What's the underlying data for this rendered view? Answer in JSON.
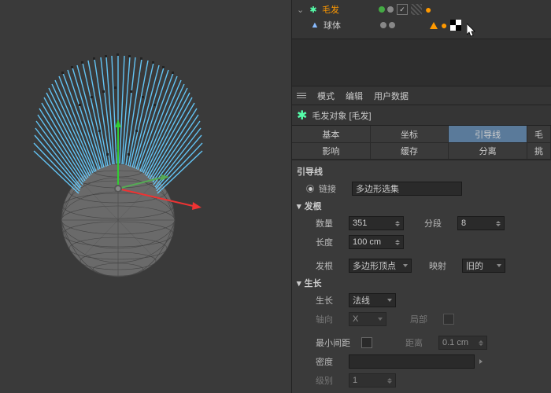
{
  "hierarchy": {
    "hair": "毛发",
    "sphere": "球体"
  },
  "menu": {
    "mode": "模式",
    "edit": "编辑",
    "userdata": "用户数据"
  },
  "object_title": "毛发对象 [毛发]",
  "tabs1": {
    "basic": "基本",
    "coord": "坐标",
    "guides": "引导线",
    "hair": "毛"
  },
  "tabs2": {
    "effects": "影响",
    "cache": "缓存",
    "separate": "分离",
    "advanced": "挑"
  },
  "sections": {
    "guides_header": "引导线",
    "link_label": "链接",
    "link_value": "多边形选集",
    "roots_header": "发根",
    "count_label": "数量",
    "count_value": "351",
    "segments_label": "分段",
    "segments_value": "8",
    "length_label": "长度",
    "length_value": "100 cm",
    "root_label": "发根",
    "root_value": "多边形顶点",
    "map_label": "映射",
    "map_value": "旧的",
    "growth_header": "生长",
    "growth_label": "生长",
    "growth_value": "法线",
    "axis_label": "轴向",
    "axis_value": "X",
    "local_label": "局部",
    "minspace_label": "最小间距",
    "distance_label": "距离",
    "distance_value": "0.1 cm",
    "density_label": "密度",
    "level_label": "级别",
    "level_value": "1"
  }
}
